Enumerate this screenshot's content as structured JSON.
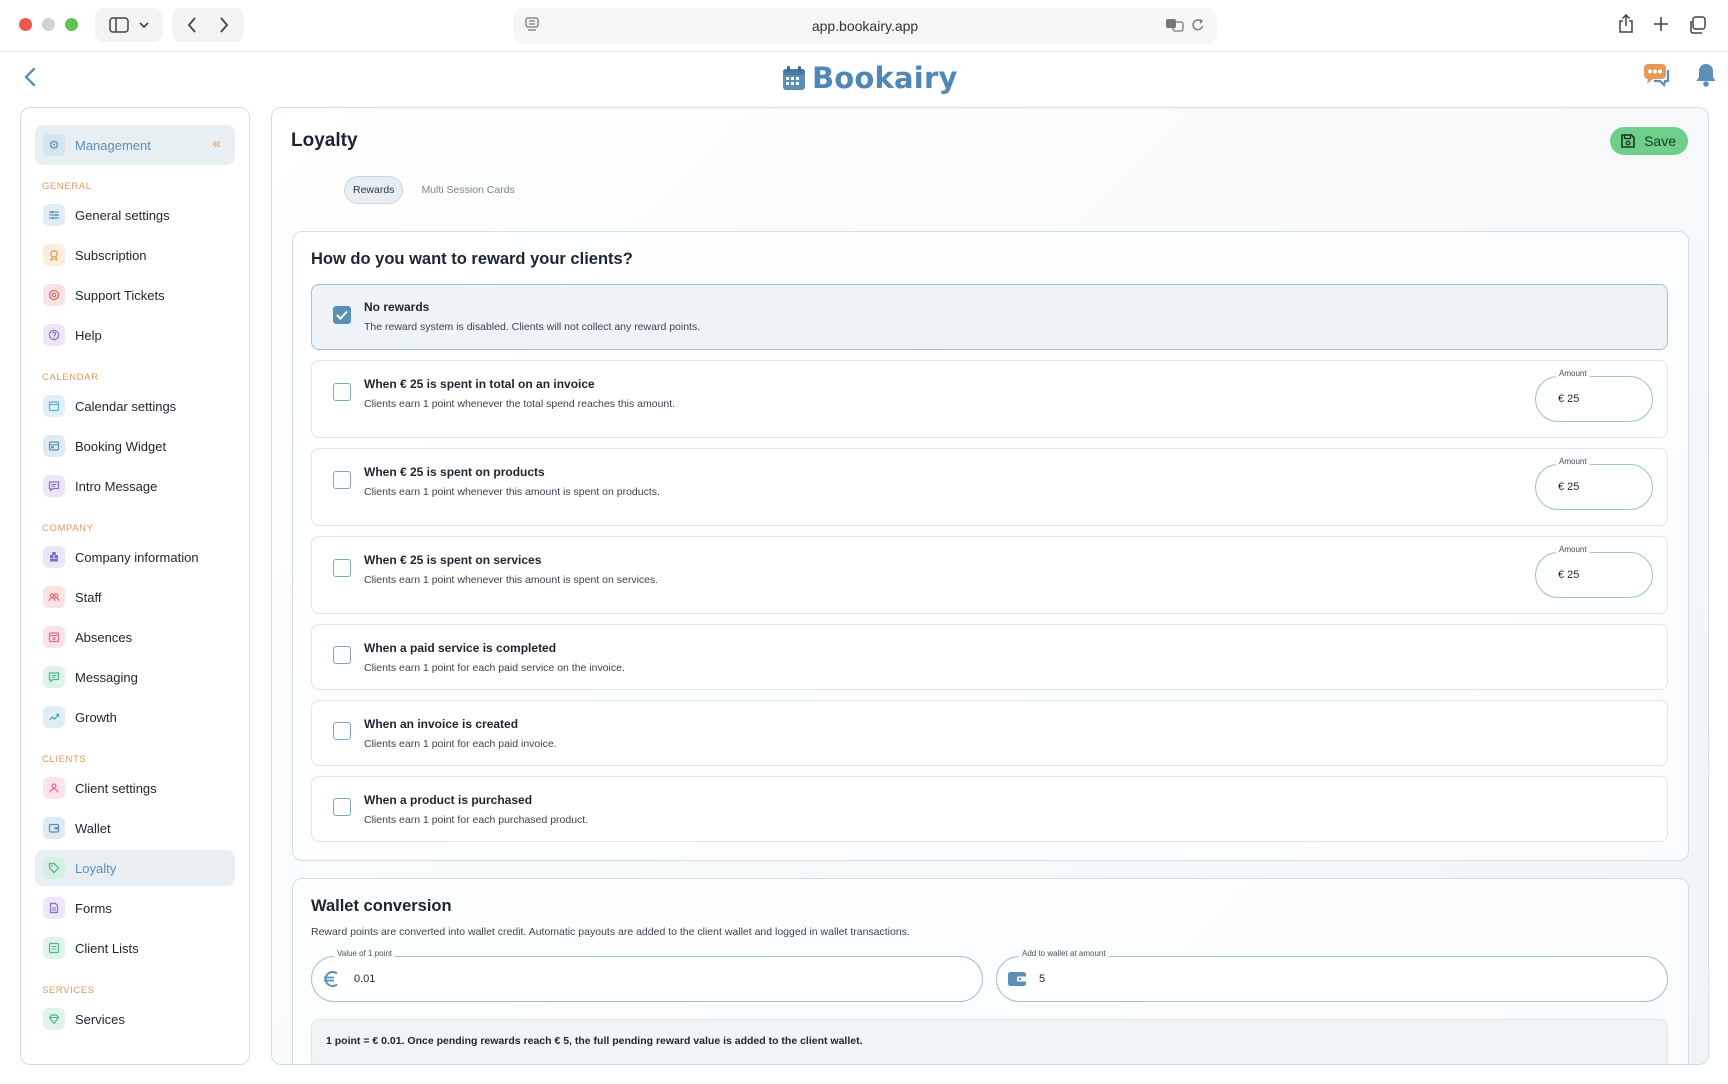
{
  "browser": {
    "url": "app.bookairy.app"
  },
  "app": {
    "logo_text": "Bookairy"
  },
  "sidebar": {
    "header": {
      "label": "Management"
    },
    "sections": [
      {
        "title": "GENERAL",
        "items": [
          {
            "label": "General settings",
            "icon": "sliders-icon",
            "color": "#6a9bc3"
          },
          {
            "label": "Subscription",
            "icon": "medal-icon",
            "color": "#e3a35a"
          },
          {
            "label": "Support Tickets",
            "icon": "lifebuoy-icon",
            "color": "#e06a6a"
          },
          {
            "label": "Help",
            "icon": "question-icon",
            "color": "#8a6fc8"
          }
        ]
      },
      {
        "title": "CALENDAR",
        "items": [
          {
            "label": "Calendar settings",
            "icon": "calendar-icon",
            "color": "#5bb1cf"
          },
          {
            "label": "Booking Widget",
            "icon": "widget-icon",
            "color": "#5b8fb8"
          },
          {
            "label": "Intro Message",
            "icon": "message-icon",
            "color": "#8a6fc8"
          }
        ]
      },
      {
        "title": "COMPANY",
        "items": [
          {
            "label": "Company information",
            "icon": "building-icon",
            "color": "#7a6fd0"
          },
          {
            "label": "Staff",
            "icon": "people-icon",
            "color": "#e06a6a"
          },
          {
            "label": "Absences",
            "icon": "calendar-x-icon",
            "color": "#e06a8a"
          },
          {
            "label": "Messaging",
            "icon": "chat-icon",
            "color": "#4fb88a"
          },
          {
            "label": "Growth",
            "icon": "trend-icon",
            "color": "#5b9fc8"
          }
        ]
      },
      {
        "title": "CLIENTS",
        "items": [
          {
            "label": "Client settings",
            "icon": "user-icon",
            "color": "#e06a8a"
          },
          {
            "label": "Wallet",
            "icon": "wallet-icon",
            "color": "#5b8fb8"
          },
          {
            "label": "Loyalty",
            "icon": "tag-icon",
            "color": "#4fb88a",
            "active": true
          },
          {
            "label": "Forms",
            "icon": "form-icon",
            "color": "#8a6fc8"
          },
          {
            "label": "Client Lists",
            "icon": "list-icon",
            "color": "#4fb88a"
          }
        ]
      },
      {
        "title": "SERVICES",
        "items": [
          {
            "label": "Services",
            "icon": "gem-icon",
            "color": "#4fb88a"
          }
        ]
      }
    ]
  },
  "main": {
    "title": "Loyalty",
    "save_label": "Save",
    "tabs": [
      {
        "label": "Rewards",
        "active": true
      },
      {
        "label": "Multi Session Cards",
        "active": false
      }
    ],
    "rewards": {
      "heading": "How do you want to reward your clients?",
      "options": [
        {
          "title": "No rewards",
          "desc": "The reward system is disabled. Clients will not collect any reward points.",
          "checked": true
        },
        {
          "title": "When € 25 is spent in total on an invoice",
          "desc": "Clients earn 1 point whenever the total spend reaches this amount.",
          "checked": false,
          "amount_label": "Amount",
          "amount_value": "€ 25"
        },
        {
          "title": "When € 25 is spent on products",
          "desc": "Clients earn 1 point whenever this amount is spent on products.",
          "checked": false,
          "amount_label": "Amount",
          "amount_value": "€ 25"
        },
        {
          "title": "When € 25 is spent on services",
          "desc": "Clients earn 1 point whenever this amount is spent on services.",
          "checked": false,
          "amount_label": "Amount",
          "amount_value": "€ 25"
        },
        {
          "title": "When a paid service is completed",
          "desc": "Clients earn 1 point for each paid service on the invoice.",
          "checked": false
        },
        {
          "title": "When an invoice is created",
          "desc": "Clients earn 1 point for each paid invoice.",
          "checked": false
        },
        {
          "title": "When a product is purchased",
          "desc": "Clients earn 1 point for each purchased product.",
          "checked": false
        }
      ]
    },
    "wallet": {
      "heading": "Wallet conversion",
      "desc": "Reward points are converted into wallet credit. Automatic payouts are added to the client wallet and logged in wallet transactions.",
      "point_value_label": "Value of 1 point",
      "point_value": "0.01",
      "threshold_label": "Add to wallet at amount",
      "threshold_value": "5",
      "note": "1 point = € 0.01. Once pending rewards reach € 5, the full pending reward value is added to the client wallet."
    }
  }
}
